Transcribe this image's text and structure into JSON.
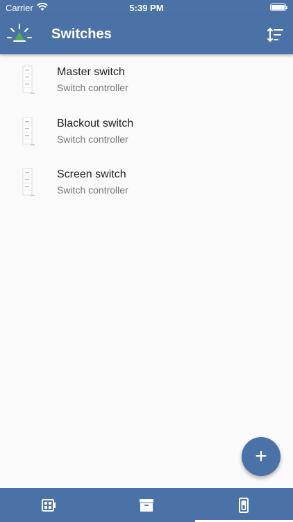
{
  "status_bar": {
    "carrier": "Carrier",
    "time": "5:39 PM"
  },
  "app_bar": {
    "title": "Switches",
    "logo_icon": "lamp-logo-icon",
    "sort_icon": "sort-icon"
  },
  "switches": [
    {
      "title": "Master switch",
      "subtitle": "Switch controller",
      "icon": "switch-device-icon"
    },
    {
      "title": "Blackout switch",
      "subtitle": "Switch controller",
      "icon": "switch-device-icon"
    },
    {
      "title": "Screen switch",
      "subtitle": "Switch controller",
      "icon": "switch-device-icon"
    }
  ],
  "fab": {
    "label": "+"
  },
  "bottom_nav": {
    "tabs": [
      {
        "icon": "controller-icon",
        "active": false
      },
      {
        "icon": "archive-icon",
        "active": false
      },
      {
        "icon": "switch-icon",
        "active": true
      }
    ]
  },
  "colors": {
    "primary": "#4a72a6",
    "logo_accent": "#4caf50",
    "background": "#fafafa",
    "title_text": "#212121",
    "subtitle_text": "#757575"
  }
}
